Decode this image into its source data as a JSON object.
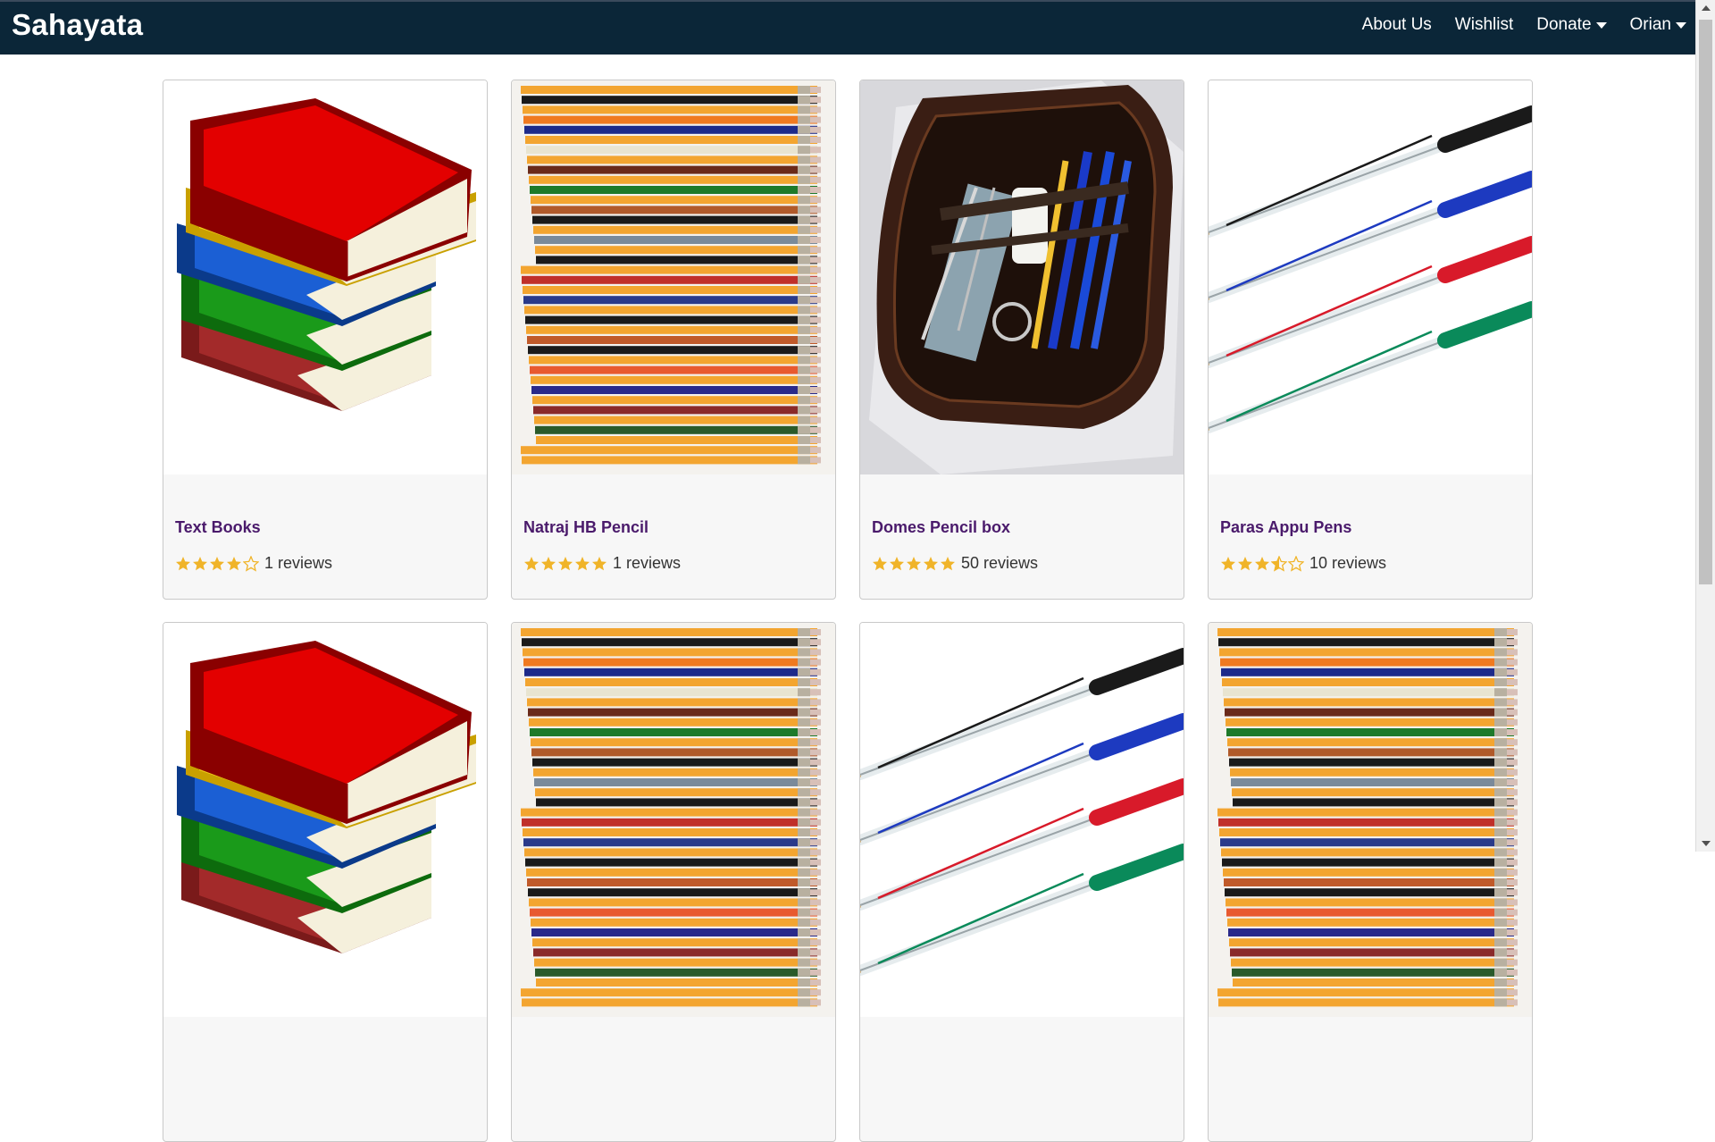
{
  "navbar": {
    "brand": "Sahayata",
    "links": [
      "About Us",
      "Wishlist",
      "Donate",
      "Orian"
    ]
  },
  "colors": {
    "navbar_bg": "#0b2638",
    "title": "#4a1a6b",
    "star": "#f0b429"
  },
  "products": [
    {
      "title": "Text Books",
      "rating": 4,
      "reviews": "1 reviews",
      "image": "books"
    },
    {
      "title": "Natraj HB Pencil",
      "rating": 5,
      "reviews": "1 reviews",
      "image": "pencils"
    },
    {
      "title": "Domes Pencil box",
      "rating": 5,
      "reviews": "50 reviews",
      "image": "pencil-box"
    },
    {
      "title": "Paras Appu Pens",
      "rating": 3.5,
      "reviews": "10 reviews",
      "image": "pens"
    },
    {
      "title": "",
      "rating": 0,
      "reviews": "",
      "image": "books"
    },
    {
      "title": "",
      "rating": 0,
      "reviews": "",
      "image": "pencils"
    },
    {
      "title": "",
      "rating": 0,
      "reviews": "",
      "image": "pens"
    },
    {
      "title": "",
      "rating": 0,
      "reviews": "",
      "image": "pencils"
    }
  ]
}
